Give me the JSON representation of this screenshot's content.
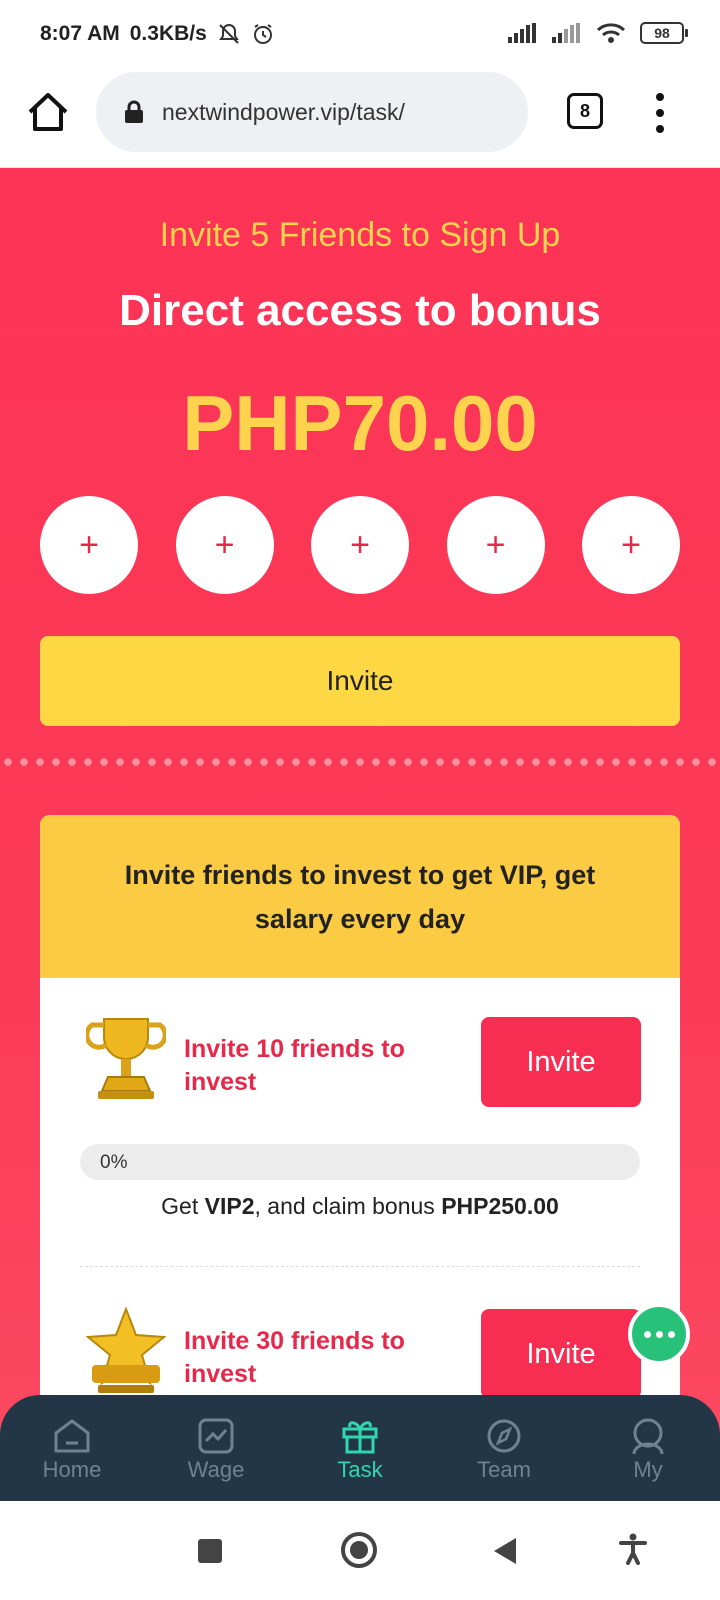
{
  "status_bar": {
    "time": "8:07 AM",
    "net_speed": "0.3KB/s",
    "battery": "98"
  },
  "browser": {
    "url": "nextwindpower.vip/task/",
    "tab_count": "8"
  },
  "promo": {
    "subtitle": "Invite 5 Friends to Sign Up",
    "title": "Direct access to bonus",
    "amount": "PHP70.00",
    "slots": [
      "+",
      "+",
      "+",
      "+",
      "+"
    ],
    "invite_label": "Invite"
  },
  "vip_card": {
    "heading": "Invite friends to invest to get VIP, get salary every day",
    "tasks": [
      {
        "icon": "trophy-icon",
        "label": "Invite 10 friends to invest",
        "button": "Invite",
        "progress_text": "0%",
        "progress_value": 0,
        "reward_prefix": "Get ",
        "reward_vip": "VIP2",
        "reward_mid": ", and claim bonus ",
        "reward_amount": "PHP250.00"
      },
      {
        "icon": "star-icon",
        "label": "Invite 30 friends to invest",
        "button": "Invite"
      }
    ]
  },
  "tabbar": {
    "items": [
      {
        "label": "Home",
        "icon": "home-icon",
        "active": false
      },
      {
        "label": "Wage",
        "icon": "chart-icon",
        "active": false
      },
      {
        "label": "Task",
        "icon": "gift-icon",
        "active": true
      },
      {
        "label": "Team",
        "icon": "compass-icon",
        "active": false
      },
      {
        "label": "My",
        "icon": "user-icon",
        "active": false
      }
    ]
  },
  "colors": {
    "primary_red": "#fd3355",
    "accent_yellow": "#ffd34d",
    "tabbar_bg": "#233648",
    "tab_active": "#30d6b0",
    "chat_green": "#27c17a"
  }
}
